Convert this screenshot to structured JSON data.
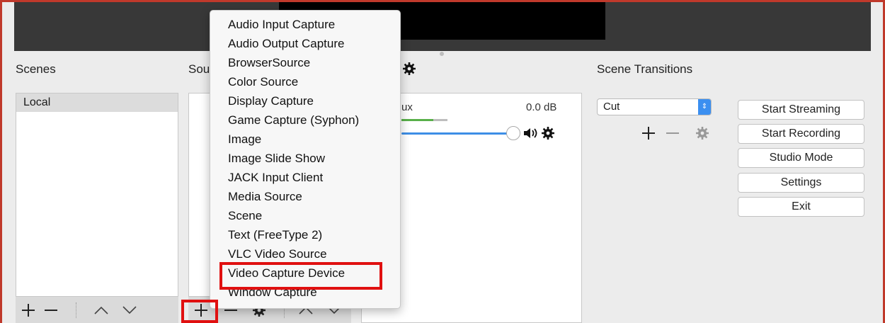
{
  "scenes": {
    "heading": "Scenes",
    "items": [
      "Local"
    ]
  },
  "sources": {
    "heading_visible": "Sou"
  },
  "mixer": {
    "channel_label": "ux",
    "db": "0.0 dB"
  },
  "transitions": {
    "heading": "Scene Transitions",
    "selected": "Cut"
  },
  "controls": {
    "start_streaming": "Start Streaming",
    "start_recording": "Start Recording",
    "studio_mode": "Studio Mode",
    "settings": "Settings",
    "exit": "Exit"
  },
  "add_source_menu": {
    "items": [
      "Audio Input Capture",
      "Audio Output Capture",
      "BrowserSource",
      "Color Source",
      "Display Capture",
      "Game Capture (Syphon)",
      "Image",
      "Image Slide Show",
      "JACK Input Client",
      "Media Source",
      "Scene",
      "Text (FreeType 2)",
      "VLC Video Source",
      "Video Capture Device",
      "Window Capture"
    ],
    "highlighted": "Video Capture Device"
  },
  "colors": {
    "highlight": "#e01010",
    "accent": "#3b8ff0",
    "meter": "#59b04a"
  },
  "icons": [
    "plus-icon",
    "minus-icon",
    "chevron-up-icon",
    "chevron-down-icon",
    "gear-icon",
    "speaker-icon"
  ]
}
